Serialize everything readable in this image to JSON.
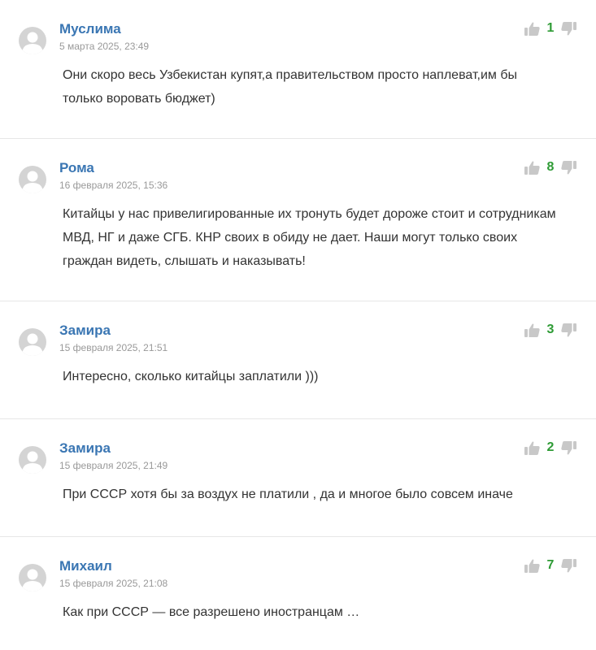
{
  "comments": [
    {
      "author": "Муслима",
      "date": "5 марта 2025, 23:49",
      "score": "1",
      "text": "Они скоро весь Узбекистан купят,а правительством просто наплеват,им бы только воровать бюджет)"
    },
    {
      "author": "Рома",
      "date": "16 февраля 2025, 15:36",
      "score": "8",
      "text": "Китайцы у нас привелигированные их тронуть будет дороже стоит и сотрудникам МВД, НГ и даже СГБ. КНР своих в обиду не дает. Наши могут только своих граждан видеть, слышать и наказывать!"
    },
    {
      "author": "Замира",
      "date": "15 февраля 2025, 21:51",
      "score": "3",
      "text": "Интересно, сколько китайцы заплатили )))"
    },
    {
      "author": "Замира",
      "date": "15 февраля 2025, 21:49",
      "score": "2",
      "text": "При СССР хотя бы за воздух не платили , да и многое было совсем иначе"
    },
    {
      "author": "Михаил",
      "date": "15 февраля 2025, 21:08",
      "score": "7",
      "text": "Как при СССР — все разрешено иностранцам …"
    }
  ],
  "icons": {
    "avatar": "user-avatar-placeholder",
    "like": "thumbs-up-icon",
    "dislike": "thumbs-down-icon"
  },
  "colors": {
    "author": "#3a76b3",
    "score": "#2e9b35",
    "date": "#999999",
    "icon": "#c8c8c8"
  }
}
